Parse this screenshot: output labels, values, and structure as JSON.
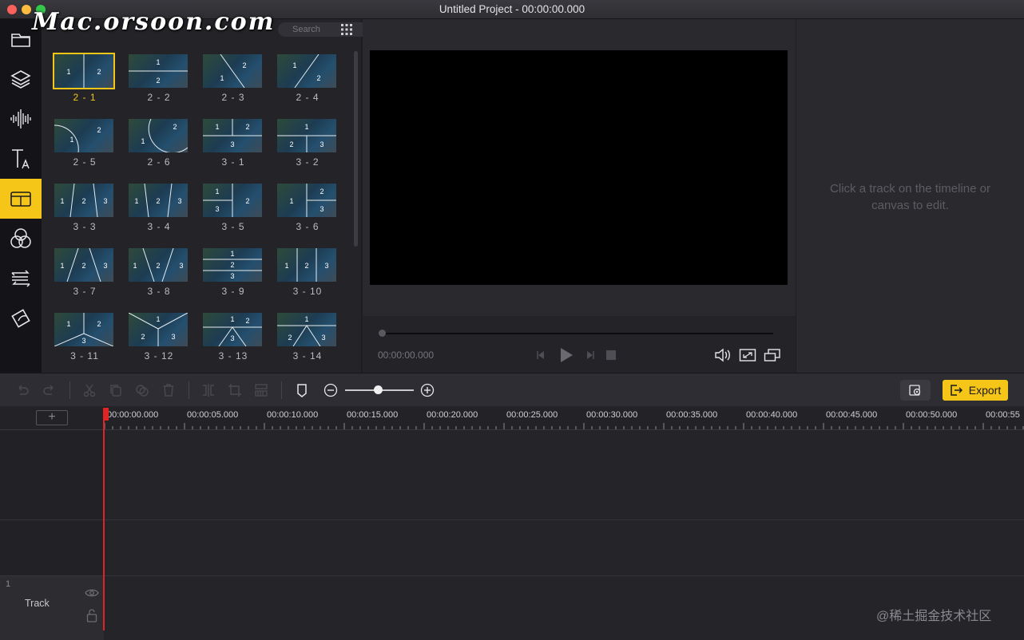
{
  "window": {
    "title": "Untitled Project - 00:00:00.000"
  },
  "watermark": "Mac.orsoon.com",
  "library": {
    "search_placeholder": "Search",
    "tiles": [
      {
        "label": "2 - 1",
        "selected": true,
        "nums": [
          "1",
          "2"
        ]
      },
      {
        "label": "2 - 2",
        "nums": [
          "1",
          "2"
        ]
      },
      {
        "label": "2 - 3",
        "nums": [
          "1",
          "2"
        ]
      },
      {
        "label": "2 - 4",
        "nums": [
          "1",
          "2"
        ]
      },
      {
        "label": "2 - 5",
        "nums": [
          "1",
          "2"
        ]
      },
      {
        "label": "2 - 6",
        "nums": [
          "1",
          "2"
        ]
      },
      {
        "label": "3 - 1",
        "nums": [
          "1",
          "2",
          "3"
        ]
      },
      {
        "label": "3 - 2",
        "nums": [
          "1",
          "2",
          "3"
        ]
      },
      {
        "label": "3 - 3",
        "nums": [
          "1",
          "2",
          "3"
        ]
      },
      {
        "label": "3 - 4",
        "nums": [
          "1",
          "2",
          "3"
        ]
      },
      {
        "label": "3 - 5",
        "nums": [
          "1",
          "2",
          "3"
        ]
      },
      {
        "label": "3 - 6",
        "nums": [
          "1",
          "2",
          "3"
        ]
      },
      {
        "label": "3 - 7",
        "nums": [
          "1",
          "2",
          "3"
        ]
      },
      {
        "label": "3 - 8",
        "nums": [
          "1",
          "2",
          "3"
        ]
      },
      {
        "label": "3 - 9",
        "nums": [
          "1",
          "2",
          "3"
        ]
      },
      {
        "label": "3 - 10",
        "nums": [
          "1",
          "2",
          "3"
        ]
      },
      {
        "label": "3 - 11",
        "nums": [
          "1",
          "2",
          "3"
        ]
      },
      {
        "label": "3 - 12",
        "nums": [
          "1",
          "2",
          "3"
        ]
      },
      {
        "label": "3 - 13",
        "nums": [
          "1",
          "2",
          "3"
        ]
      },
      {
        "label": "3 - 14",
        "nums": [
          "1",
          "2",
          "3"
        ]
      }
    ]
  },
  "left_tools": [
    {
      "name": "media-tool",
      "icon": "folder-icon"
    },
    {
      "name": "layers-tool",
      "icon": "layers-icon"
    },
    {
      "name": "audio-tool",
      "icon": "waveform-icon"
    },
    {
      "name": "text-tool",
      "icon": "text-icon"
    },
    {
      "name": "split-screen-tool",
      "icon": "split-screen-icon",
      "active": true
    },
    {
      "name": "filters-tool",
      "icon": "filters-icon"
    },
    {
      "name": "transitions-tool",
      "icon": "transitions-icon"
    },
    {
      "name": "elements-tool",
      "icon": "elements-icon"
    }
  ],
  "preview": {
    "timecode": "00:00:00.000",
    "progress": 0
  },
  "properties": {
    "empty_message": "Click a track on the timeline or canvas to edit."
  },
  "toolbar": {
    "export_label": "Export"
  },
  "timeline": {
    "ruler_labels": [
      "00:00:00.000",
      "00:00:05.000",
      "00:00:10.000",
      "00:00:15.000",
      "00:00:20.000",
      "00:00:25.000",
      "00:00:30.000",
      "00:00:35.000",
      "00:00:40.000",
      "00:00:45.000",
      "00:00:50.000",
      "00:00:55"
    ],
    "add_track": "+",
    "track": {
      "number": "1",
      "name": "Track"
    }
  },
  "corner_watermark": "@稀土掘金技术社区",
  "colors": {
    "accent": "#f5c518",
    "playhead": "#e02424",
    "canvas": "#000000"
  }
}
